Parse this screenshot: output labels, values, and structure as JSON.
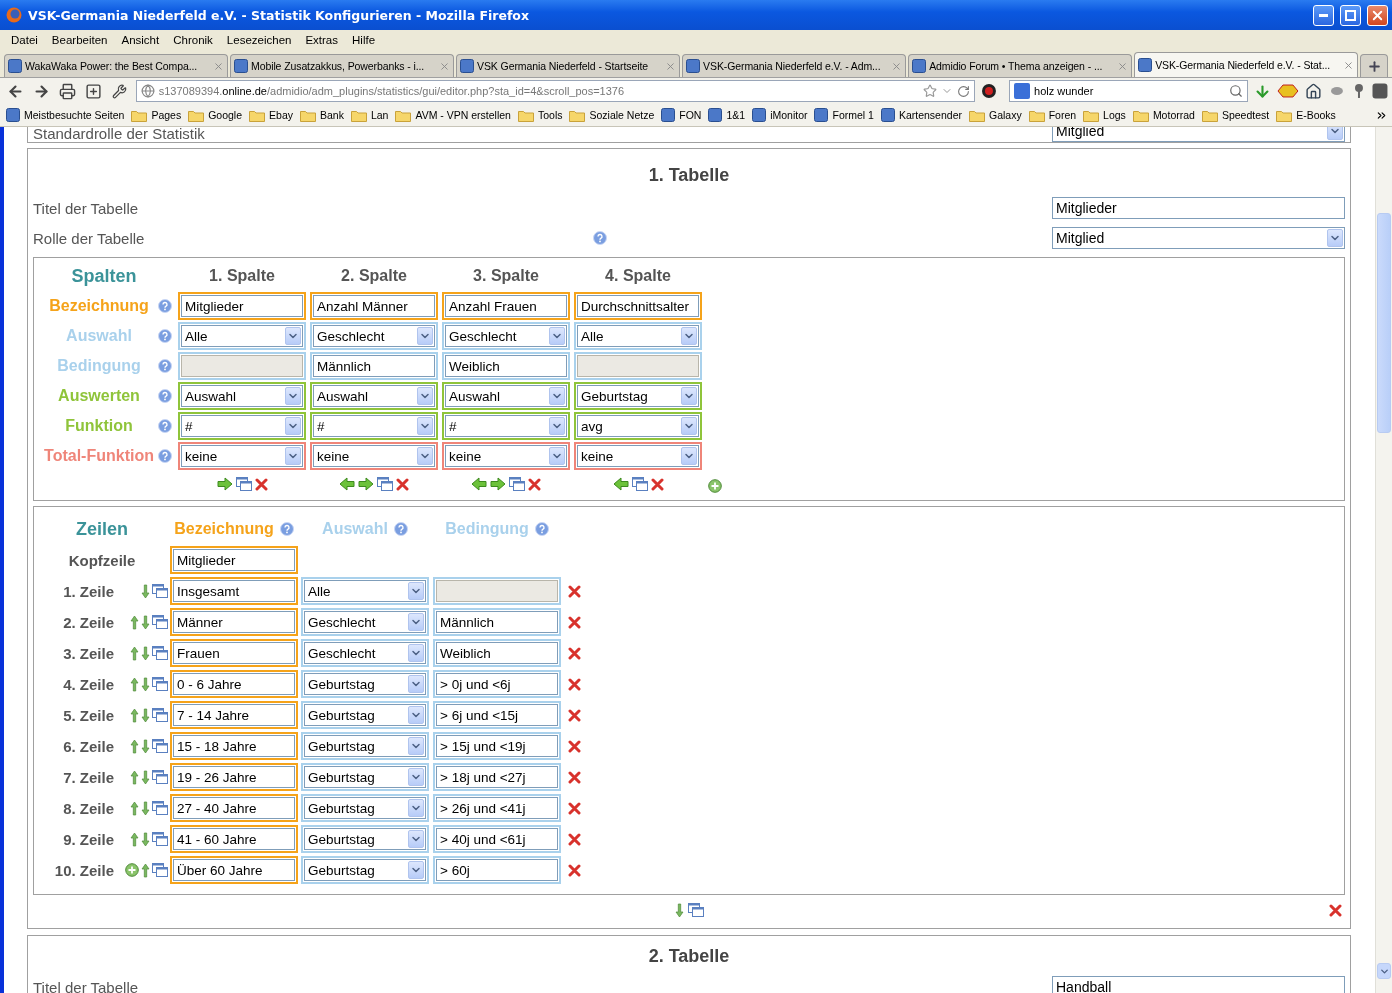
{
  "window": {
    "title": "VSK-Germania Niederfeld e.V.  - Statistik Konfigurieren - Mozilla Firefox"
  },
  "menu": [
    "Datei",
    "Bearbeiten",
    "Ansicht",
    "Chronik",
    "Lesezeichen",
    "Extras",
    "Hilfe"
  ],
  "tabs": [
    {
      "label": "WakaWaka Power: the Best Compa...",
      "selected": false
    },
    {
      "label": "Mobile Zusatzakkus, Powerbanks - i...",
      "selected": false
    },
    {
      "label": "VSK Germania Niederfeld - Startseite",
      "selected": false
    },
    {
      "label": "VSK-Germania Niederfeld e.V. - Adm...",
      "selected": false
    },
    {
      "label": "Admidio Forum • Thema anzeigen - ...",
      "selected": false
    },
    {
      "label": "VSK-Germania Niederfeld e.V. - Stat...",
      "selected": true
    }
  ],
  "address": {
    "subdomain": "s137089394.",
    "domain": "online.de",
    "path": "/admidio/adm_plugins/statistics/gui/editor.php?sta_id=4&scroll_pos=1376"
  },
  "search": {
    "value": "holz wunder"
  },
  "bookmarks": [
    {
      "label": "Meistbesuchte Seiten",
      "kind": "site"
    },
    {
      "label": "Pages",
      "kind": "folder"
    },
    {
      "label": "Google",
      "kind": "folder"
    },
    {
      "label": "Ebay",
      "kind": "folder"
    },
    {
      "label": "Bank",
      "kind": "folder"
    },
    {
      "label": "Lan",
      "kind": "folder"
    },
    {
      "label": "AVM - VPN erstellen",
      "kind": "folder"
    },
    {
      "label": "Tools",
      "kind": "folder"
    },
    {
      "label": "Soziale Netze",
      "kind": "folder"
    },
    {
      "label": "FON",
      "kind": "site"
    },
    {
      "label": "1&1",
      "kind": "site"
    },
    {
      "label": "iMonitor",
      "kind": "site"
    },
    {
      "label": "Formel 1",
      "kind": "site"
    },
    {
      "label": "Kartensender",
      "kind": "site"
    },
    {
      "label": "Galaxy",
      "kind": "folder"
    },
    {
      "label": "Foren",
      "kind": "folder"
    },
    {
      "label": "Logs",
      "kind": "folder"
    },
    {
      "label": "Motorrad",
      "kind": "folder"
    },
    {
      "label": "Speedtest",
      "kind": "folder"
    },
    {
      "label": "E-Books",
      "kind": "folder"
    }
  ],
  "page": {
    "top_row": {
      "label": "Standardrolle der Statistik",
      "value": "Mitglied"
    },
    "table_1": {
      "heading": "1. Tabelle",
      "title_label": "Titel der Tabelle",
      "title_value": "Mitglieder",
      "role_label": "Rolle der Tabelle",
      "role_value": "Mitglied",
      "columns_box": {
        "heading": "Spalten",
        "add_column": true,
        "row_labels": [
          {
            "label": "Bezeichnung",
            "color": "#f5a31a"
          },
          {
            "label": "Auswahl",
            "color": "#a9d1ec"
          },
          {
            "label": "Bedingung",
            "color": "#a9d1ec"
          },
          {
            "label": "Auswerten",
            "color": "#8fc43a"
          },
          {
            "label": "Funktion",
            "color": "#8fc43a"
          },
          {
            "label": "Total-Funktion",
            "color": "#ef8579"
          }
        ],
        "columns": [
          {
            "heading": "1. Spalte",
            "actions": [
              {
                "kind": "right"
              },
              {
                "kind": "copy"
              },
              {
                "kind": "delete"
              }
            ],
            "fields": [
              {
                "kind": "text",
                "value": "Mitglieder",
                "disabled": false
              },
              {
                "kind": "select",
                "value": "Alle"
              },
              {
                "kind": "text",
                "disabled": true
              },
              {
                "kind": "select",
                "value": "Auswahl"
              },
              {
                "kind": "select",
                "value": "#"
              },
              {
                "kind": "select",
                "value": "keine"
              }
            ]
          },
          {
            "heading": "2. Spalte",
            "actions": [
              {
                "kind": "left"
              },
              {
                "kind": "right"
              },
              {
                "kind": "copy"
              },
              {
                "kind": "delete"
              }
            ],
            "fields": [
              {
                "kind": "text",
                "value": "Anzahl Männer",
                "disabled": false
              },
              {
                "kind": "select",
                "value": "Geschlecht"
              },
              {
                "kind": "text",
                "value": "Männlich",
                "disabled": false
              },
              {
                "kind": "select",
                "value": "Auswahl"
              },
              {
                "kind": "select",
                "value": "#"
              },
              {
                "kind": "select",
                "value": "keine"
              }
            ]
          },
          {
            "heading": "3. Spalte",
            "actions": [
              {
                "kind": "left"
              },
              {
                "kind": "right"
              },
              {
                "kind": "copy"
              },
              {
                "kind": "delete"
              }
            ],
            "fields": [
              {
                "kind": "text",
                "value": "Anzahl Frauen",
                "disabled": false
              },
              {
                "kind": "select",
                "value": "Geschlecht"
              },
              {
                "kind": "text",
                "value": "Weiblich",
                "disabled": false
              },
              {
                "kind": "select",
                "value": "Auswahl"
              },
              {
                "kind": "select",
                "value": "#"
              },
              {
                "kind": "select",
                "value": "keine"
              }
            ]
          },
          {
            "heading": "4. Spalte",
            "actions": [
              {
                "kind": "left"
              },
              {
                "kind": "copy"
              },
              {
                "kind": "delete"
              }
            ],
            "fields": [
              {
                "kind": "text",
                "value": "Durchschnittsalter",
                "disabled": false
              },
              {
                "kind": "select",
                "value": "Alle"
              },
              {
                "kind": "text",
                "disabled": true
              },
              {
                "kind": "select",
                "value": "Geburtstag"
              },
              {
                "kind": "select",
                "value": "avg"
              },
              {
                "kind": "select",
                "value": "keine"
              }
            ]
          }
        ]
      },
      "rows_box": {
        "heading": "Zeilen",
        "column_headers": [
          {
            "label": "Bezeichnung",
            "color": "#f5a31a"
          },
          {
            "label": "Auswahl",
            "color": "#a9d1ec"
          },
          {
            "label": "Bedingung",
            "color": "#a9d1ec"
          }
        ],
        "header_row": {
          "label": "Kopfzeile",
          "value": "Mitglieder"
        },
        "rows": [
          {
            "label": "1. Zeile",
            "actions": [
              {
                "kind": "down"
              },
              {
                "kind": "copy"
              }
            ],
            "name": "Insgesamt",
            "selection": "Alle",
            "condition_disabled": true
          },
          {
            "label": "2. Zeile",
            "actions": [
              {
                "kind": "up"
              },
              {
                "kind": "down"
              },
              {
                "kind": "copy"
              }
            ],
            "name": "Männer",
            "selection": "Geschlecht",
            "condition": "Männlich",
            "condition_disabled": false
          },
          {
            "label": "3. Zeile",
            "actions": [
              {
                "kind": "up"
              },
              {
                "kind": "down"
              },
              {
                "kind": "copy"
              }
            ],
            "name": "Frauen",
            "selection": "Geschlecht",
            "condition": "Weiblich",
            "condition_disabled": false
          },
          {
            "label": "4. Zeile",
            "actions": [
              {
                "kind": "up"
              },
              {
                "kind": "down"
              },
              {
                "kind": "copy"
              }
            ],
            "name": "0 - 6 Jahre",
            "selection": "Geburtstag",
            "condition": "> 0j und <6j",
            "condition_disabled": false
          },
          {
            "label": "5. Zeile",
            "actions": [
              {
                "kind": "up"
              },
              {
                "kind": "down"
              },
              {
                "kind": "copy"
              }
            ],
            "name": "7 - 14 Jahre",
            "selection": "Geburtstag",
            "condition": "> 6j und <15j",
            "condition_disabled": false
          },
          {
            "label": "6. Zeile",
            "actions": [
              {
                "kind": "up"
              },
              {
                "kind": "down"
              },
              {
                "kind": "copy"
              }
            ],
            "name": "15 - 18 Jahre",
            "selection": "Geburtstag",
            "condition": "> 15j und <19j",
            "condition_disabled": false
          },
          {
            "label": "7. Zeile",
            "actions": [
              {
                "kind": "up"
              },
              {
                "kind": "down"
              },
              {
                "kind": "copy"
              }
            ],
            "name": "19 - 26 Jahre",
            "selection": "Geburtstag",
            "condition": "> 18j und <27j",
            "condition_disabled": false
          },
          {
            "label": "8. Zeile",
            "actions": [
              {
                "kind": "up"
              },
              {
                "kind": "down"
              },
              {
                "kind": "copy"
              }
            ],
            "name": "27 - 40 Jahre",
            "selection": "Geburtstag",
            "condition": "> 26j und <41j",
            "condition_disabled": false
          },
          {
            "label": "9. Zeile",
            "actions": [
              {
                "kind": "up"
              },
              {
                "kind": "down"
              },
              {
                "kind": "copy"
              }
            ],
            "name": "41 - 60  Jahre",
            "selection": "Geburtstag",
            "condition": "> 40j und <61j",
            "condition_disabled": false
          },
          {
            "label": "10. Zeile",
            "actions": [
              {
                "kind": "add"
              },
              {
                "kind": "up"
              },
              {
                "kind": "copy"
              }
            ],
            "name": "Über 60  Jahre",
            "selection": "Geburtstag",
            "condition": "> 60j",
            "condition_disabled": false
          }
        ]
      },
      "table_actions": [
        {
          "kind": "down"
        },
        {
          "kind": "copy"
        }
      ]
    },
    "table_2": {
      "heading": "2. Tabelle",
      "title_label": "Titel der Tabelle",
      "title_value": "Handball"
    }
  }
}
